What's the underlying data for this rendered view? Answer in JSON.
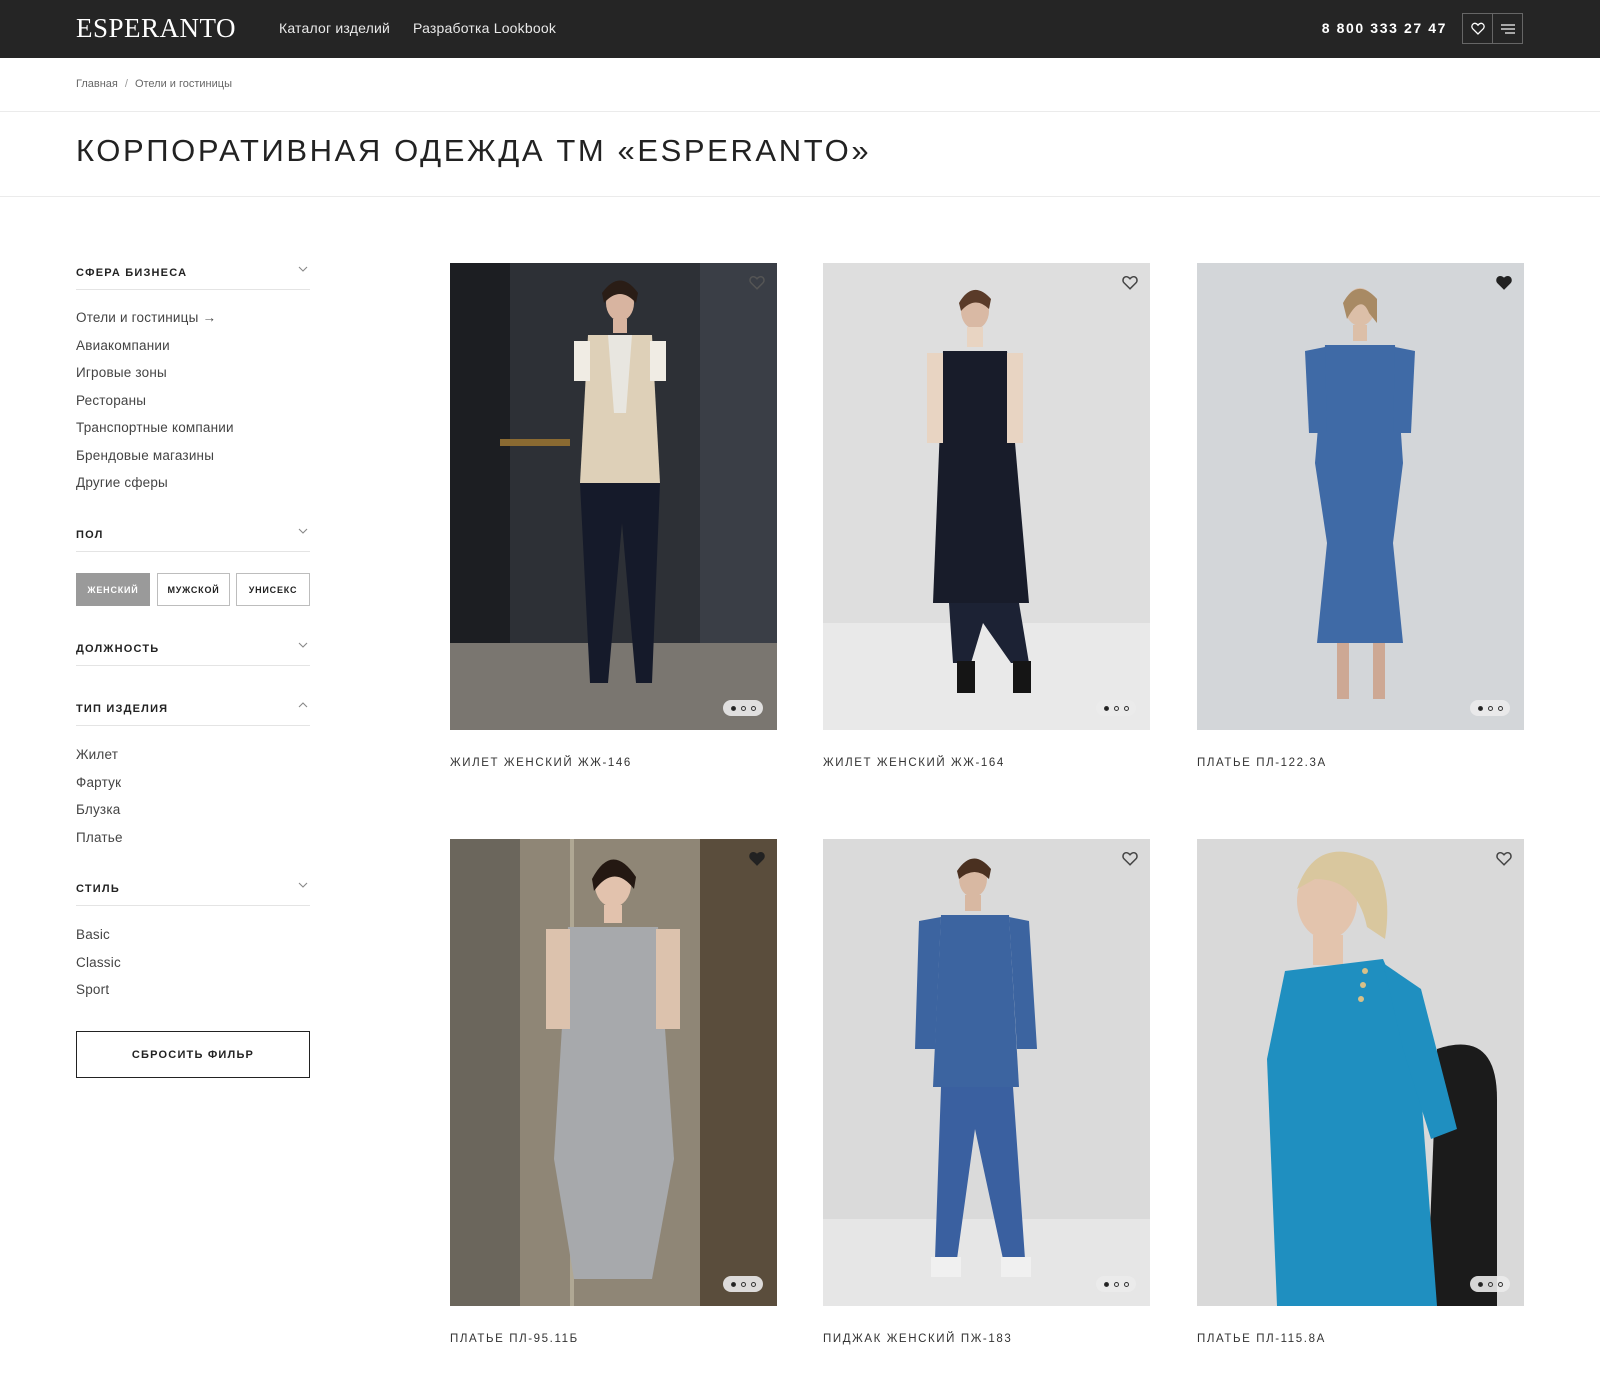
{
  "header": {
    "logo": "ESPERANTO",
    "nav": [
      "Каталог изделий",
      "Разработка Lookbook"
    ],
    "phone": "8 800 333 27 47",
    "icons": [
      "heart-icon",
      "menu-icon"
    ]
  },
  "breadcrumb": [
    "Главная",
    "Отели и гостиницы"
  ],
  "page_title": "КОРПОРАТИВНАЯ ОДЕЖДА ТМ «ESPERANTO»",
  "sidebar": {
    "business": {
      "title": "СФЕРА БИЗНЕСА",
      "items": [
        "Отели и гостиницы →",
        "Авиакомпании",
        "Игровые зоны",
        "Рестораны",
        "Транспортные компании",
        "Брендовые магазины",
        "Другие сферы"
      ]
    },
    "gender": {
      "title": "ПОЛ",
      "options": [
        "ЖЕНСКИЙ",
        "МУЖСКОЙ",
        "УНИСЕКС"
      ],
      "selected": "ЖЕНСКИЙ"
    },
    "position": {
      "title": "ДОЛЖНОСТЬ"
    },
    "item_type": {
      "title": "ТИП ИЗДЕЛИЯ",
      "items": [
        "Жилет",
        "Фартук",
        "Блузка",
        "Платье"
      ]
    },
    "style": {
      "title": "СТИЛЬ",
      "items": [
        "Basic",
        "Classic",
        "Sport"
      ]
    },
    "reset_label": "СБРОСИТЬ ФИЛЬР"
  },
  "products": [
    {
      "name": "ЖИЛЕТ ЖЕНСКИЙ ЖЖ-146",
      "favorited": false
    },
    {
      "name": "ЖИЛЕТ ЖЕНСКИЙ ЖЖ-164",
      "favorited": false
    },
    {
      "name": "ПЛАТЬЕ ПЛ-122.3А",
      "favorited": true
    },
    {
      "name": "ПЛАТЬЕ ПЛ-95.11Б",
      "favorited": true
    },
    {
      "name": "ПИДЖАК ЖЕНСКИЙ ПЖ-183",
      "favorited": false
    },
    {
      "name": "ПЛАТЬЕ ПЛ-115.8А",
      "favorited": false
    }
  ],
  "colors": {
    "header_bg": "#252525",
    "active_pill": "#9a9a9a"
  }
}
